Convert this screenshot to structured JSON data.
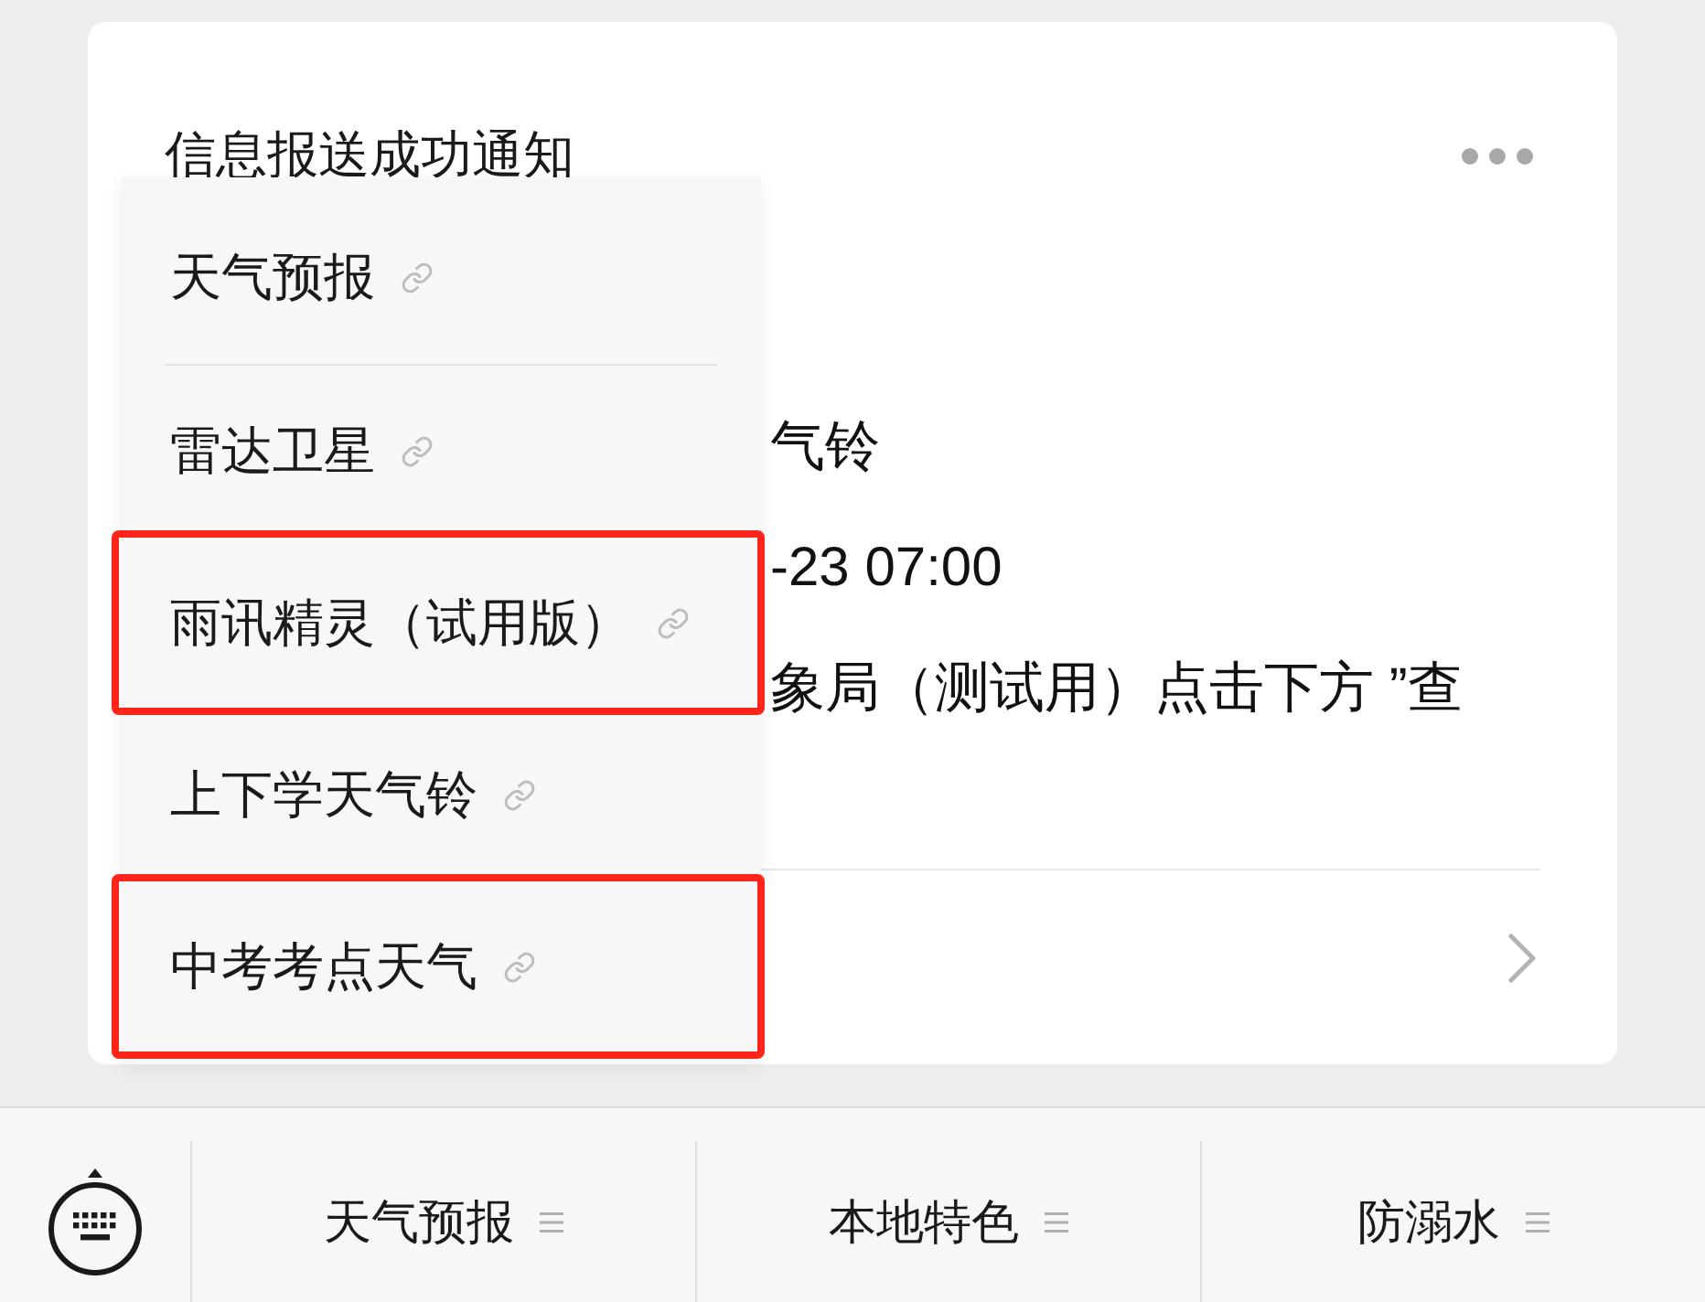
{
  "card": {
    "title": "信息报送成功通知",
    "body_lines": [
      "气铃",
      "-23 07:00",
      "象局（测试用）点击下方 ”查"
    ]
  },
  "menu": {
    "items": [
      {
        "label": "天气预报",
        "highlighted": false
      },
      {
        "label": "雷达卫星",
        "highlighted": false
      },
      {
        "label": "雨讯精灵（试用版）",
        "highlighted": true
      },
      {
        "label": "上下学天气铃",
        "highlighted": false
      },
      {
        "label": "中考考点天气",
        "highlighted": true
      }
    ]
  },
  "bottom_bar": {
    "tabs": [
      {
        "label": "天气预报"
      },
      {
        "label": "本地特色"
      },
      {
        "label": "防溺水"
      }
    ]
  }
}
